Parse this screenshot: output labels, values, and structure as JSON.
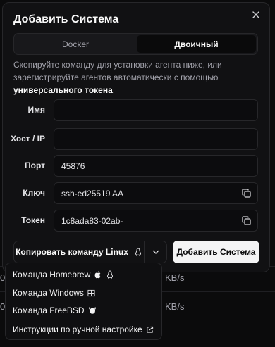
{
  "background": {
    "row1_fragment": "KB/s",
    "row2_fragment": "KB/s",
    "left_fragment_1": "0",
    "left_fragment_2": "0"
  },
  "dialog": {
    "title": "Добавить Система",
    "tabs": [
      "Docker",
      "Двоичный"
    ],
    "active_tab": "Двоичный",
    "description_prefix": "Скопируйте команду для установки агента ниже, или зарегистрируйте агентов автоматически с помощью ",
    "description_bold": "универсального токена",
    "description_suffix": ".",
    "fields": {
      "name_label": "Имя",
      "name_value": "",
      "host_label": "Хост / IP",
      "host_value": "",
      "port_label": "Порт",
      "port_value": "45876",
      "key_label": "Ключ",
      "key_value": "ssh-ed25519 AA",
      "token_label": "Токен",
      "token_value": "1c8ada83-02ab-"
    },
    "copy_command_label": "Копировать команду Linux",
    "add_button_label": "Добавить Система"
  },
  "menu": {
    "items": [
      {
        "label": "Команда Homebrew",
        "icons": [
          "apple-icon",
          "linux-icon"
        ]
      },
      {
        "label": "Команда Windows",
        "icons": [
          "windows-icon"
        ]
      },
      {
        "label": "Команда FreeBSD",
        "icons": [
          "freebsd-icon"
        ]
      },
      {
        "label": "Инструкции по ручной настройке",
        "icons": [
          "external-link-icon"
        ]
      }
    ]
  }
}
